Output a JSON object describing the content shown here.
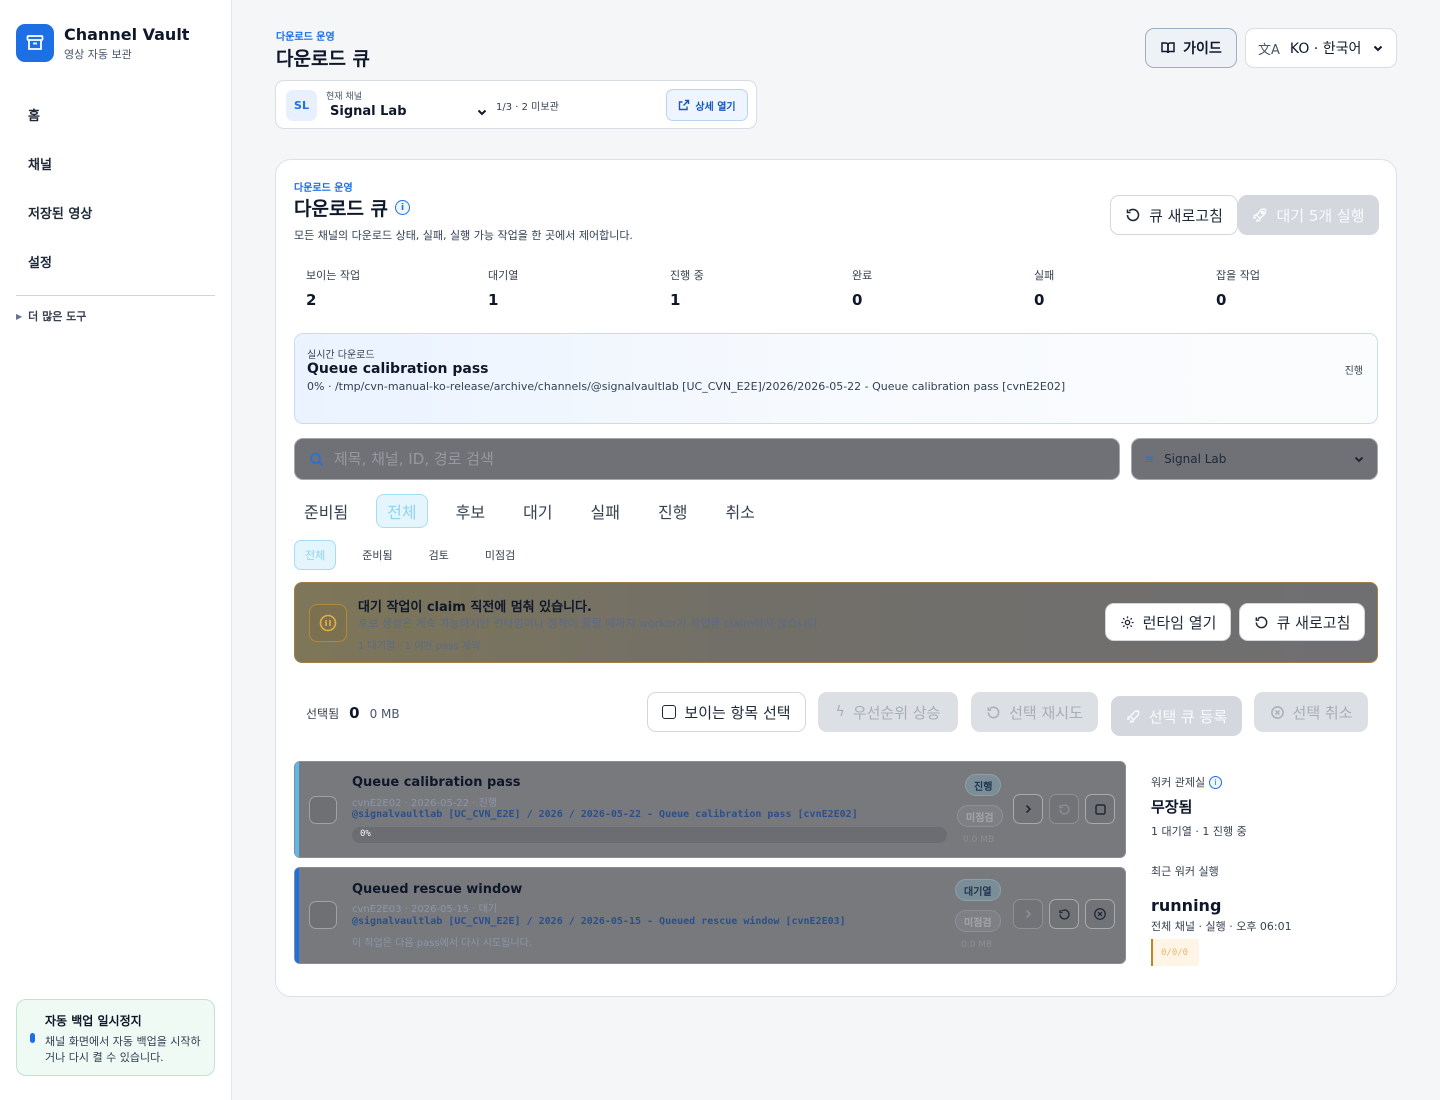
{
  "brand": {
    "name": "Channel Vault",
    "subtitle": "영상 자동 보관"
  },
  "sidebar": {
    "items": [
      {
        "label": "홈"
      },
      {
        "label": "채널"
      },
      {
        "label": "저장된 영상"
      },
      {
        "label": "설정"
      }
    ],
    "more_tools": "더 많은 도구",
    "backup": {
      "title": "자동 백업 일시정지",
      "description": "채널 화면에서 자동 백업을 시작하거나 다시 켤 수 있습니다."
    }
  },
  "header": {
    "eyebrow": "다운로드 운영",
    "title": "다운로드 큐",
    "channel": {
      "avatar": "SL",
      "label": "현재 채널",
      "selected": "Signal Lab",
      "count": "1/3 · 2 미보관",
      "detail_button": "상세 열기"
    },
    "guide_button": "가이드",
    "language": "KO · 한국어"
  },
  "queue": {
    "eyebrow": "다운로드 운영",
    "title": "다운로드 큐",
    "description": "모든 채널의 다운로드 상태, 실패, 실행 가능 작업을 한 곳에서 제어합니다.",
    "refresh_button": "큐 새로고침",
    "run_button": "대기 5개 실행",
    "stats": [
      {
        "label": "보이는 작업",
        "value": "2"
      },
      {
        "label": "대기열",
        "value": "1"
      },
      {
        "label": "진행 중",
        "value": "1"
      },
      {
        "label": "완료",
        "value": "0"
      },
      {
        "label": "실패",
        "value": "0"
      },
      {
        "label": "잡을 작업",
        "value": "0"
      }
    ],
    "live": {
      "label": "실시간 다운로드",
      "title": "Queue calibration pass",
      "path": "0% · /tmp/cvn-manual-ko-release/archive/channels/@signalvaultlab [UC_CVN_E2E]/2026/2026-05-22 - Queue calibration pass [cvnE2E02]",
      "status": "진행"
    },
    "search_placeholder": "제목, 채널, ID, 경로 검색",
    "channel_filter": "Signal Lab",
    "tabs": [
      {
        "label": "준비됨"
      },
      {
        "label": "전체"
      },
      {
        "label": "후보"
      },
      {
        "label": "대기"
      },
      {
        "label": "실패"
      },
      {
        "label": "진행"
      },
      {
        "label": "취소"
      }
    ],
    "subtabs": [
      {
        "label": "전체"
      },
      {
        "label": "준비됨"
      },
      {
        "label": "검토"
      },
      {
        "label": "미점검"
      }
    ],
    "alert": {
      "title": "대기 작업이 claim 직전에 멈춰 있습니다.",
      "description": "후보 생성은 계속 가능하지만 런타임이나 정책이 풀릴 때까지 worker가 작업을 claim하지 않습니다.",
      "meta": "1 대기열 · 1 이번 pass 제외",
      "runtime_button": "런타임 열기",
      "refresh_button": "큐 새로고침"
    },
    "selection": {
      "label": "선택됨",
      "count": "0",
      "size": "0 MB",
      "select_visible": "보이는 항목 선택",
      "priority_up": "우선순위 상승",
      "retry": "선택 재시도",
      "enqueue": "선택 큐 등록",
      "cancel": "선택 취소"
    },
    "jobs": [
      {
        "title": "Queue calibration pass",
        "subtitle": "cvnE2E02 · 2026-05-22 · 진행",
        "path": "@signalvaultlab [UC_CVN_E2E] / 2026 / 2026-05-22 - Queue calibration pass [cvnE2E02]",
        "progress": "0%",
        "status": "진행",
        "check": "미점검",
        "size": "0.0 MB",
        "bar_color": "#5bb8e8"
      },
      {
        "title": "Queued rescue window",
        "subtitle": "cvnE2E03 · 2026-05-15 · 대기",
        "path": "@signalvaultlab [UC_CVN_E2E] / 2026 / 2026-05-15 - Queued rescue window [cvnE2E03]",
        "note": "이 작업은 다음 pass에서 다시 시도됩니다.",
        "status": "대기열",
        "check": "미점검",
        "size": "0.0 MB",
        "bar_color": "#1d6fe6"
      }
    ],
    "worker": {
      "label": "워커 관제실",
      "state": "무장됨",
      "meta": "1 대기열 · 1 진행 중",
      "recent_label": "최근 워커 실행",
      "recent_status": "running",
      "recent_meta": "전체 채널 · 실행 · 오후 06:01",
      "recent_counts": "0/0/0"
    }
  },
  "colors": {
    "accent": "#1d6fe6",
    "warning": "#c2861d"
  }
}
